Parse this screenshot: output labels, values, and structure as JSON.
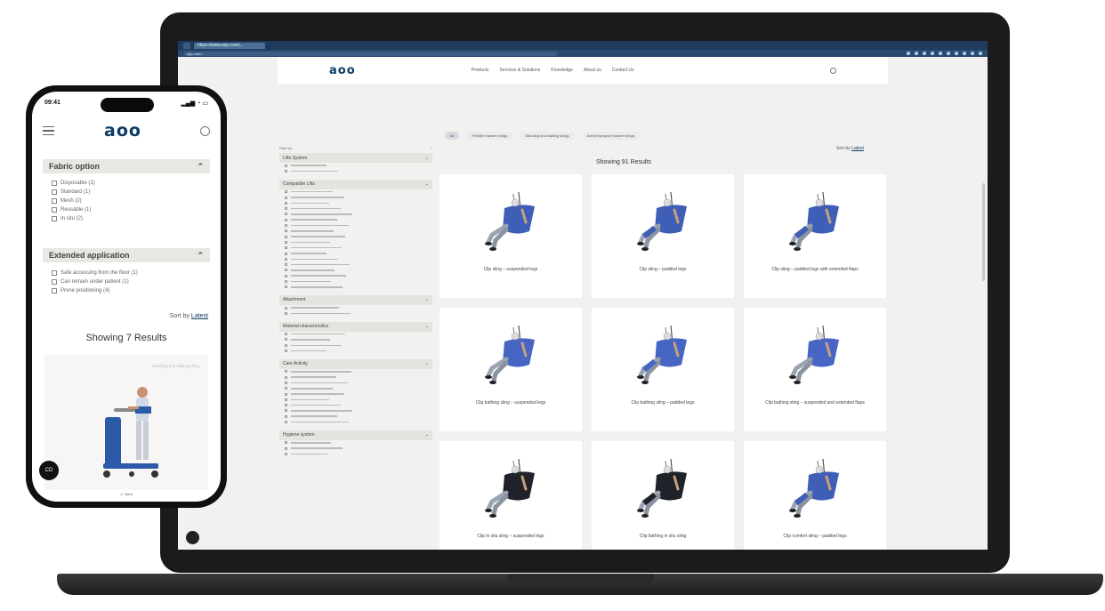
{
  "laptop": {
    "browser": {
      "tabs": [
        "",
        "https://www.arjo.com/..."
      ],
      "url": "arjo.com/..."
    },
    "header": {
      "logo": "aoo",
      "nav": [
        "Products",
        "Services & Solutions",
        "Knowledge",
        "About us",
        "Contact Us"
      ]
    },
    "chips": [
      "All",
      "Flexible transfer slings",
      "Standing and walking slings",
      "Active/transport transfer slings"
    ],
    "filter_header": "Filter by",
    "filter_toggle": "+",
    "filter_groups": [
      {
        "title": "Lifts System",
        "options": [
          "",
          ""
        ]
      },
      {
        "title": "Compatible Lifts",
        "options": [
          "",
          "",
          "",
          "",
          "",
          "",
          "",
          "",
          "",
          "",
          "",
          "",
          "",
          "",
          "",
          "",
          "",
          ""
        ]
      },
      {
        "title": "Attachment",
        "options": [
          "",
          ""
        ]
      },
      {
        "title": "Material characteristics",
        "options": [
          "",
          "",
          "",
          ""
        ]
      },
      {
        "title": "Care Activity",
        "options": [
          "",
          "",
          "",
          "",
          "",
          "",
          "",
          "",
          "",
          ""
        ]
      },
      {
        "title": "Hygiene system",
        "options": [
          "",
          "",
          ""
        ]
      }
    ],
    "sort_label": "Sort by",
    "sort_value": "Latest",
    "results_title": "Showing 91 Results",
    "products": [
      {
        "name": "Clip sling – suspended legs",
        "tag": "",
        "color": "#3f5eb5",
        "legs": "suspended"
      },
      {
        "name": "Clip sling – padded legs",
        "tag": "",
        "color": "#3f5eb5",
        "legs": "padded"
      },
      {
        "name": "Clip sling – padded legs with extended flaps",
        "tag": "",
        "color": "#3f5eb5",
        "legs": "padded"
      },
      {
        "name": "Clip bathing sling – suspended legs",
        "tag": "",
        "color": "#4766c4",
        "legs": "suspended"
      },
      {
        "name": "Clip bathing sling – padded legs",
        "tag": "",
        "color": "#4766c4",
        "legs": "padded"
      },
      {
        "name": "Clip bathing sling – suspended and extended flaps",
        "tag": "",
        "color": "#4766c4",
        "legs": "suspended"
      },
      {
        "name": "Clip in situ sling – suspended legs",
        "tag": "",
        "color": "#1f2329",
        "legs": "suspended"
      },
      {
        "name": "Clip bathing in situ sling",
        "tag": "",
        "color": "#1f2329",
        "legs": "padded"
      },
      {
        "name": "Clip comfort sling – padded legs",
        "tag": "",
        "color": "#3f5eb5",
        "legs": "padded"
      }
    ]
  },
  "phone": {
    "time": "09:41",
    "status_icons": "▂▄▆ ◔ ▭",
    "logo": "aoo",
    "groups": [
      {
        "title": "Fabric option",
        "options": [
          "Disposable (1)",
          "Standard (1)",
          "Mesh (2)",
          "Reusable (1)",
          "In situ (2)"
        ]
      },
      {
        "title": "Extended application",
        "options": [
          "Safe accessing from the floor (1)",
          "Can remain under patient (1)",
          "Prone positioning (4)"
        ]
      }
    ],
    "sort_label": "Sort by",
    "sort_value": "Latest",
    "results_title": "Showing 7 Results",
    "card_tag": "Standing and walking sling",
    "chat_label": "CD",
    "pager": "1 / Next"
  },
  "colors": {
    "brand": "#0d3b66",
    "sling_blue": "#3f5eb5",
    "panel": "#e5e3e0"
  }
}
